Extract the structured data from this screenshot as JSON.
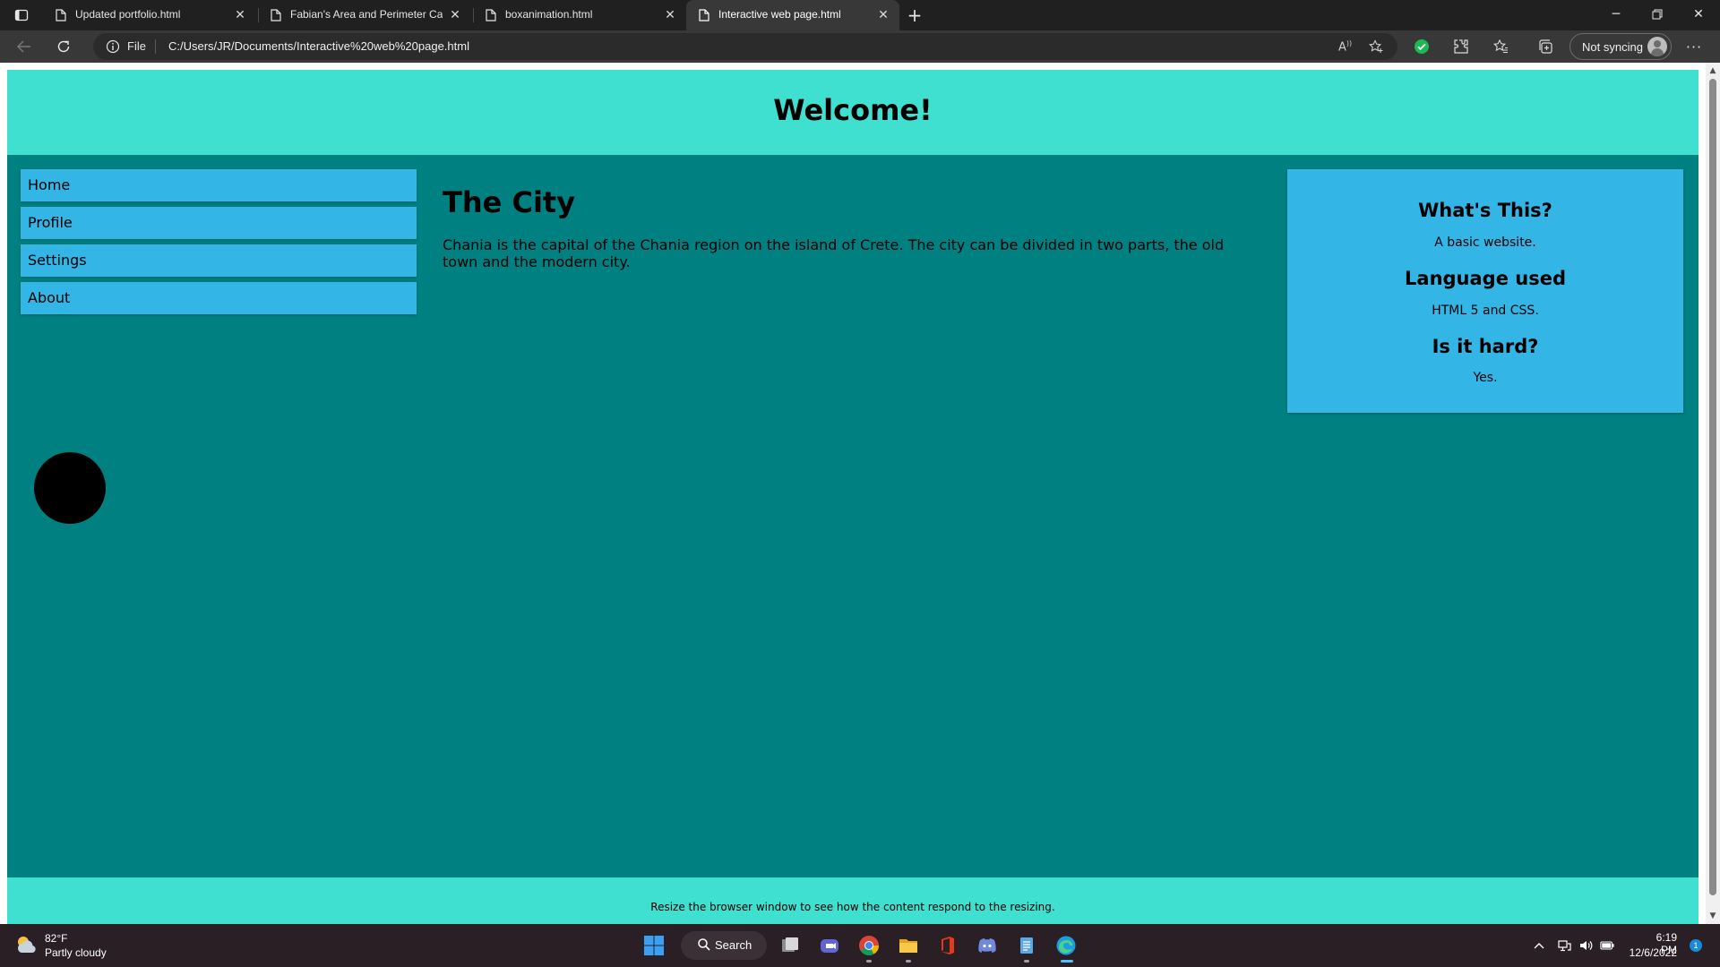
{
  "browser": {
    "tabs": [
      {
        "label": "Updated portfolio.html",
        "active": false
      },
      {
        "label": "Fabian's Area and Perimeter Calc",
        "active": false
      },
      {
        "label": "boxanimation.html",
        "active": false
      },
      {
        "label": "Interactive web page.html",
        "active": true
      }
    ],
    "address": {
      "scheme": "File",
      "url": "C:/Users/JR/Documents/Interactive%20web%20page.html"
    },
    "profile_label": "Not syncing",
    "icons": [
      "tab-actions-icon",
      "back-icon",
      "refresh-icon",
      "info-icon",
      "read-aloud-icon",
      "add-favorite-icon",
      "extension-check-icon",
      "extensions-icon",
      "favorites-icon",
      "collections-icon",
      "more-icon"
    ]
  },
  "page": {
    "header_title": "Welcome!",
    "menu": [
      "Home",
      "Profile",
      "Settings",
      "About"
    ],
    "main": {
      "heading": "The City",
      "paragraph": "Chania is the capital of the Chania region on the island of Crete. The city can be divided in two parts, the old town and the modern city."
    },
    "aside": {
      "sections": [
        {
          "heading": "What's This?",
          "text": "A basic website."
        },
        {
          "heading": "Language used",
          "text": "HTML 5 and CSS."
        },
        {
          "heading": "Is it hard?",
          "text": "Yes."
        }
      ]
    },
    "footer_text": "Resize the browser window to see how the content respond to the resizing.",
    "colors": {
      "page_background": "#008080",
      "header_footer": "#40e0d0",
      "menu_aside": "#33b5e5",
      "ball": "#000000"
    }
  },
  "taskbar": {
    "weather": {
      "temp": "82°F",
      "desc": "Partly cloudy"
    },
    "search_label": "Search",
    "apps": [
      "start-icon",
      "task-view-icon",
      "chat-icon",
      "chrome-icon",
      "file-explorer-icon",
      "office-icon",
      "discord-icon",
      "notepad-icon",
      "edge-icon"
    ],
    "tray": [
      "chevron-up-icon",
      "network-icon",
      "volume-icon",
      "battery-icon"
    ],
    "clock": {
      "time": "6:19 PM",
      "date": "12/6/2022"
    },
    "notifications": "1"
  }
}
